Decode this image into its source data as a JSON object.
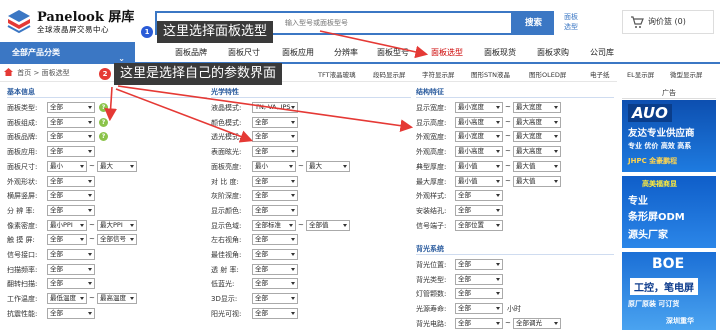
{
  "brand": {
    "name": "Panelook 屏库",
    "tagline": "全球液晶屏交易中心"
  },
  "search": {
    "placeholder": "输入型号或面板型号",
    "button": "搜索"
  },
  "select_link": "面板选型",
  "cart": {
    "label": "询价篮 (0)"
  },
  "nav": {
    "all_categories": "全部产品分类",
    "tabs": [
      "面板品牌",
      "面板尺寸",
      "面板应用",
      "分辨率",
      "面板型号",
      "面板选型",
      "面板现货",
      "面板求购",
      "公司库"
    ],
    "active": "面板选型"
  },
  "breadcrumb": {
    "home": "首页",
    "sep": ">",
    "current": "面板选型"
  },
  "subtabs": [
    "TFT液晶玻璃",
    "段码显示屏",
    "字符显示屏",
    "图形STN液晶",
    "图形OLED屏",
    "电子纸",
    "EL显示屏",
    "微型显示屏"
  ],
  "sections": {
    "basic": {
      "title": "基本信息",
      "rows": [
        {
          "label": "面板类型:",
          "value": "全部"
        },
        {
          "label": "面板组成:",
          "value": "全部"
        },
        {
          "label": "面板品牌:",
          "value": "全部"
        },
        {
          "label": "面板应用:",
          "value": "全部"
        },
        {
          "label": "面板尺寸:",
          "value": "最小",
          "value2": "最大"
        },
        {
          "label": "外观形状:",
          "value": "全部"
        },
        {
          "label": "横屏竖屏:",
          "value": "全部"
        },
        {
          "label": "分 辨 率:",
          "value": "全部"
        },
        {
          "label": "像素密度:",
          "value": "最小PPI",
          "value2": "最大PPI"
        },
        {
          "label": "触 摸 屏:",
          "value": "全部",
          "value2": "全部信号"
        },
        {
          "label": "信号接口:",
          "value": "全部"
        },
        {
          "label": "扫描频率:",
          "value": "全部"
        },
        {
          "label": "翻转扫描:",
          "value": "全部"
        },
        {
          "label": "工作温度:",
          "value": "最低温度",
          "value2": "最高温度"
        },
        {
          "label": "抗震性能:",
          "value": "全部"
        }
      ]
    },
    "optical": {
      "title": "光学特性",
      "rows": [
        {
          "label": "液晶模式:",
          "value": "TN, VA, IPS"
        },
        {
          "label": "颜色模式:",
          "value": "全部"
        },
        {
          "label": "透光模式:",
          "value": "全部"
        },
        {
          "label": "表面眩光:",
          "value": "全部"
        },
        {
          "label": "面板亮度:",
          "value": "最小",
          "value2": "最大"
        },
        {
          "label": "对 比 度:",
          "value": "全部"
        },
        {
          "label": "灰阶深度:",
          "value": "全部"
        },
        {
          "label": "显示颜色:",
          "value": "全部"
        },
        {
          "label": "显示色域:",
          "value": "全部标准",
          "value2": "全部值"
        },
        {
          "label": "左右视角:",
          "value": "全部"
        },
        {
          "label": "最佳视角:",
          "value": "全部"
        },
        {
          "label": "透 射 率:",
          "value": "全部"
        },
        {
          "label": "低蓝光:",
          "value": "全部"
        },
        {
          "label": "3D显示:",
          "value": "全部"
        },
        {
          "label": "阳光可视:",
          "value": "全部"
        }
      ]
    },
    "structure": {
      "title": "结构特征",
      "rows": [
        {
          "label": "显示宽度:",
          "value": "最小宽度",
          "value2": "最大宽度"
        },
        {
          "label": "显示高度:",
          "value": "最小高度",
          "value2": "最大高度"
        },
        {
          "label": "外观宽度:",
          "value": "最小宽度",
          "value2": "最大宽度"
        },
        {
          "label": "外观高度:",
          "value": "最小高度",
          "value2": "最大高度"
        },
        {
          "label": "典型厚度:",
          "value": "最小值",
          "value2": "最大值"
        },
        {
          "label": "最大厚度:",
          "value": "最小值",
          "value2": "最大值"
        },
        {
          "label": "外观样式:",
          "value": "全部"
        },
        {
          "label": "安装结孔:",
          "value": "全部"
        },
        {
          "label": "信号端子:",
          "value": "全部位置"
        }
      ]
    },
    "backlight": {
      "title": "背光系统",
      "rows": [
        {
          "label": "背光位置:",
          "value": "全部"
        },
        {
          "label": "背光类型:",
          "value": "全部"
        },
        {
          "label": "灯管颗数:",
          "value": "全部"
        },
        {
          "label": "光源寿命:",
          "value": "全部",
          "suffix": "小时"
        },
        {
          "label": "背光电路:",
          "value": "全部",
          "value2": "全部调光"
        }
      ]
    }
  },
  "ads": {
    "title": "广告",
    "a1": {
      "brand": "AUO",
      "line1": "友达专业供应商",
      "line2": "专业 优价 高效 高系",
      "line3": "JHPC 金豪鹏程"
    },
    "a2": {
      "line0": "高美福商显",
      "line1": "专业",
      "line2": "条形屏ODM",
      "line3": "源头厂家"
    },
    "a3": {
      "brand": "BOE",
      "line1": "工控，笔电屏",
      "line2": "原厂原装 可订货",
      "line3": "深圳重华"
    }
  },
  "annotations": {
    "a1": {
      "num": "1",
      "text": "这里选择面板选型"
    },
    "a2": {
      "num": "2",
      "text": "这里是选择自己的参数界面"
    }
  },
  "colors": {
    "brand_blue": "#3b77c4",
    "overlay": "#3a3a3a",
    "arrow": "#e53935",
    "step1": "#2a5bd7",
    "step2": "#e53935"
  }
}
